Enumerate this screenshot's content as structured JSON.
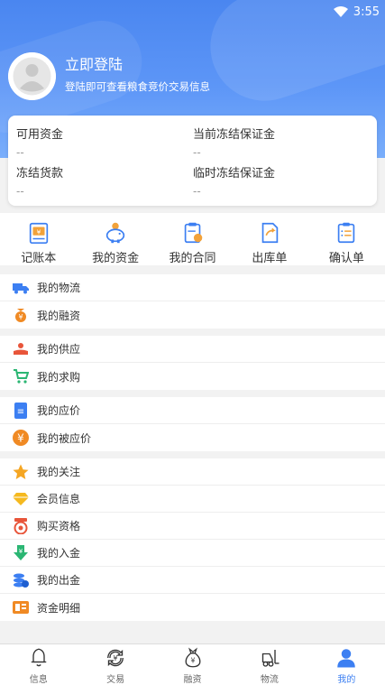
{
  "status": {
    "time": "3:55"
  },
  "profile": {
    "login_title": "立即登陆",
    "login_subtitle": "登陆即可查看粮食竞价交易信息"
  },
  "funds": {
    "available_label": "可用资金",
    "available_value": "--",
    "current_margin_label": "当前冻结保证金",
    "current_margin_value": "--",
    "frozen_payment_label": "冻结货款",
    "frozen_payment_value": "--",
    "temp_margin_label": "临时冻结保证金",
    "temp_margin_value": "--"
  },
  "quick_actions": [
    {
      "label": "记账本",
      "icon": "ledger-icon"
    },
    {
      "label": "我的资金",
      "icon": "piggy-bank-icon"
    },
    {
      "label": "我的合同",
      "icon": "contract-icon"
    },
    {
      "label": "出库单",
      "icon": "outbound-order-icon"
    },
    {
      "label": "确认单",
      "icon": "confirmation-icon"
    }
  ],
  "menu_groups": [
    [
      {
        "label": "我的物流",
        "icon": "truck-icon"
      },
      {
        "label": "我的融资",
        "icon": "finance-icon"
      }
    ],
    [
      {
        "label": "我的供应",
        "icon": "supply-icon"
      },
      {
        "label": "我的求购",
        "icon": "cart-icon"
      }
    ],
    [
      {
        "label": "我的应价",
        "icon": "bid-icon"
      },
      {
        "label": "我的被应价",
        "icon": "yen-icon"
      }
    ],
    [
      {
        "label": "我的关注",
        "icon": "star-icon"
      },
      {
        "label": "会员信息",
        "icon": "diamond-icon"
      },
      {
        "label": "购买资格",
        "icon": "qualification-icon"
      },
      {
        "label": "我的入金",
        "icon": "deposit-icon"
      },
      {
        "label": "我的出金",
        "icon": "withdraw-icon"
      },
      {
        "label": "资金明细",
        "icon": "fund-detail-icon"
      }
    ]
  ],
  "tabs": [
    {
      "label": "信息",
      "icon": "bell-icon"
    },
    {
      "label": "交易",
      "icon": "exchange-icon"
    },
    {
      "label": "融资",
      "icon": "money-bag-icon"
    },
    {
      "label": "物流",
      "icon": "forklift-icon"
    },
    {
      "label": "我的",
      "icon": "user-icon"
    }
  ],
  "colors": {
    "brand": "#3c7ff2",
    "header": "#5d96f7"
  }
}
